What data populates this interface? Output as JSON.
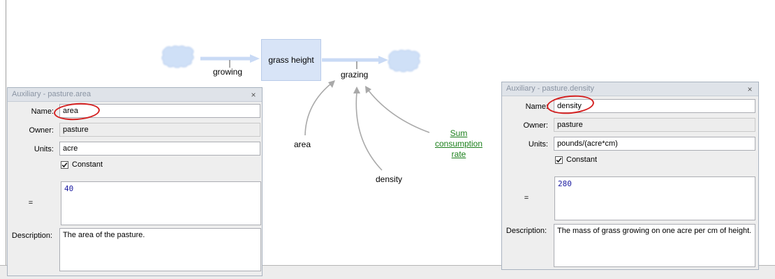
{
  "diagram": {
    "stock_label": "grass height",
    "inflow_label": "growing",
    "outflow_label": "grazing",
    "var_area": "area",
    "var_density": "density",
    "var_sum_lines": [
      "Sum",
      "consumption",
      "rate"
    ]
  },
  "dialog_area": {
    "title": "Auxiliary - pasture.area",
    "close": "×",
    "name_label": "Name:",
    "name_value": "area",
    "owner_label": "Owner:",
    "owner_value": "pasture",
    "units_label": "Units:",
    "units_value": "acre",
    "constant_label": "Constant",
    "constant_checked": true,
    "equals_label": "=",
    "equation": "40",
    "description_label": "Description:",
    "description": "The area of the pasture."
  },
  "dialog_density": {
    "title": "Auxiliary - pasture.density",
    "close": "×",
    "name_label": "Name:",
    "name_value": "density",
    "owner_label": "Owner:",
    "owner_value": "pasture",
    "units_label": "Units:",
    "units_value": "pounds/(acre*cm)",
    "constant_label": "Constant",
    "constant_checked": true,
    "equals_label": "=",
    "equation": "280",
    "description_label": "Description:",
    "description": "The mass of grass growing on one acre per cm of height."
  },
  "colors": {
    "accent_link": "#1a7f1a",
    "annotation": "#d42020",
    "stock_fill": "#d8e4f7"
  }
}
